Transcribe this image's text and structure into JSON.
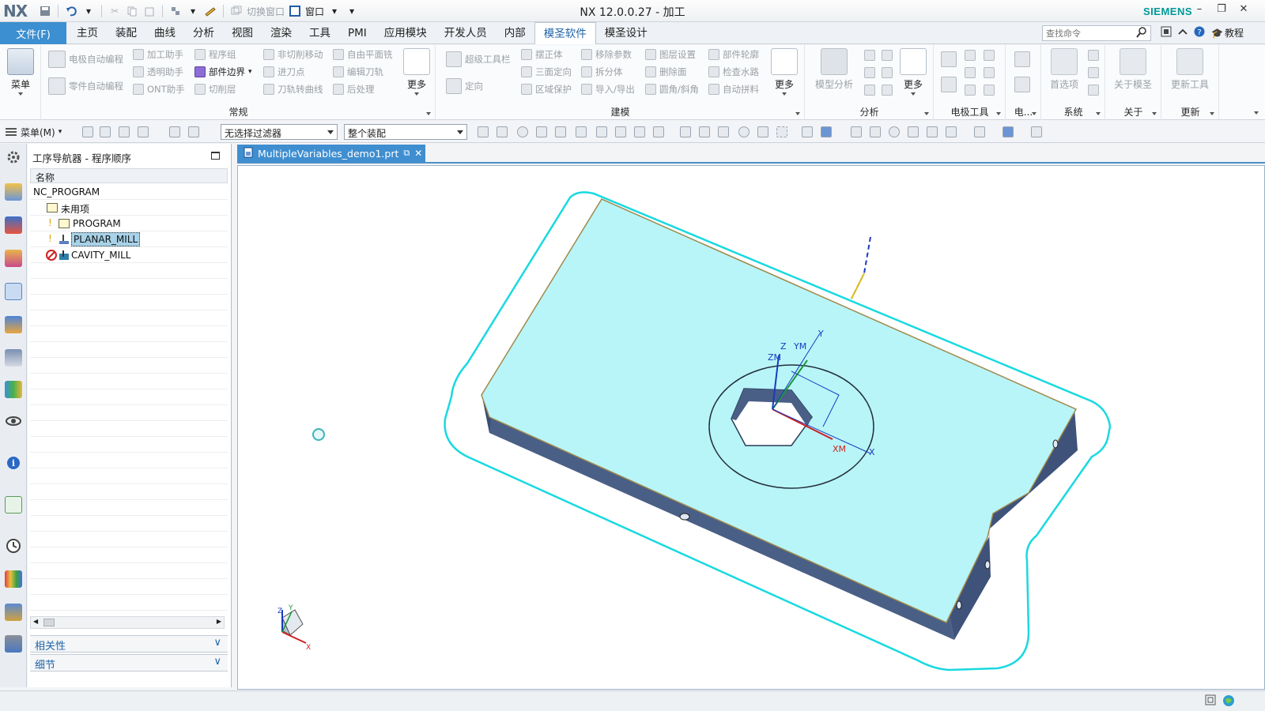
{
  "titlebar": {
    "logo": "NX",
    "window_title": "NX 12.0.0.27 - 加工",
    "brand": "SIEMENS",
    "switch_window": "切换窗口",
    "window_menu": "窗口"
  },
  "tabs": {
    "file": "文件(F)",
    "items": [
      "主页",
      "装配",
      "曲线",
      "分析",
      "视图",
      "渲染",
      "工具",
      "PMI",
      "应用模块",
      "开发人员",
      "内部",
      "模圣软件",
      "模圣设计"
    ],
    "active": "模圣软件",
    "search_placeholder": "查找命令",
    "tutorial": "教程"
  },
  "ribbon": {
    "menu_label": "菜单",
    "group_general": {
      "label": "常规",
      "buttons": [
        "电极自动编程",
        "加工助手",
        "程序组",
        "非切削移动",
        "自由平面铣",
        "零件自动编程",
        "透明助手",
        "部件边界",
        "进刀点",
        "编辑刀轨",
        "ONT助手",
        "切削层",
        "刀轨转曲线",
        "后处理"
      ],
      "more": "更多"
    },
    "group_model": {
      "label": "建模",
      "buttons": [
        "超级工具栏",
        "摆正体",
        "移除参数",
        "图层设置",
        "部件轮廓",
        "三面定向",
        "拆分体",
        "删除面",
        "检查水路",
        "定向",
        "区域保护",
        "导入/导出",
        "圆角/斜角",
        "自动拼料"
      ],
      "more": "更多"
    },
    "group_analysis": {
      "label": "分析",
      "model_analysis": "模型分析",
      "more": "更多"
    },
    "group_electrode": {
      "label": "电极工具"
    },
    "group_e2": {
      "label": "电..."
    },
    "group_system": {
      "label": "系统",
      "prefs": "首选项"
    },
    "group_about": {
      "label": "关于",
      "about": "关于模圣"
    },
    "group_update": {
      "label": "更新",
      "update": "更新工具"
    }
  },
  "toolbar2": {
    "menu": "菜单(M)",
    "filter": "无选择过滤器",
    "assembly": "整个装配"
  },
  "navigator": {
    "title": "工序导航器 - 程序顺序",
    "column": "名称",
    "rows": [
      {
        "label": "NC_PROGRAM"
      },
      {
        "label": "未用项"
      },
      {
        "label": "PROGRAM"
      },
      {
        "label": "PLANAR_MILL"
      },
      {
        "label": "CAVITY_MILL"
      }
    ],
    "dependencies": "相关性",
    "details": "细节"
  },
  "viewport": {
    "doc_tab": "MultipleVariables_demo1.prt",
    "csys_labels": {
      "z": "Z",
      "zm": "ZM",
      "ym": "YM",
      "y": "Y",
      "xm": "XM",
      "x": "X"
    },
    "triad_labels": {
      "z": "Z",
      "y": "Y",
      "x": "X"
    },
    "colors": {
      "part_top": "#b8f5f8",
      "part_side": "#4a5f86",
      "toolpath": "#19d9e0",
      "edge": "#a08a4c"
    }
  }
}
